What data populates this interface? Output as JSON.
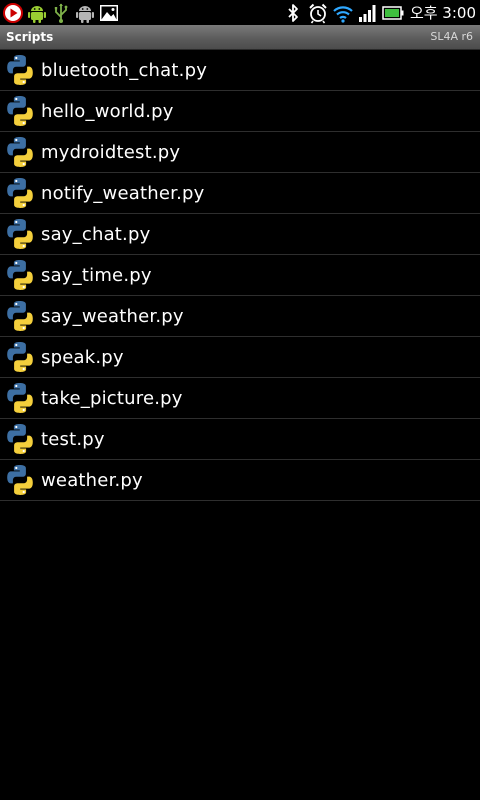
{
  "status_bar": {
    "left_icons": [
      "media-play-icon",
      "android-icon",
      "usb-icon",
      "android-debug-icon",
      "gallery-icon"
    ],
    "right_icons": [
      "bluetooth-icon",
      "alarm-icon",
      "wifi-icon",
      "signal-icon",
      "battery-icon"
    ],
    "clock": "오후 3:00"
  },
  "title_bar": {
    "title": "Scripts",
    "version": "SL4A r6"
  },
  "scripts": [
    {
      "name": "bluetooth_chat.py"
    },
    {
      "name": "hello_world.py"
    },
    {
      "name": "mydroidtest.py"
    },
    {
      "name": "notify_weather.py"
    },
    {
      "name": "say_chat.py"
    },
    {
      "name": "say_time.py"
    },
    {
      "name": "say_weather.py"
    },
    {
      "name": "speak.py"
    },
    {
      "name": "take_picture.py"
    },
    {
      "name": "test.py"
    },
    {
      "name": "weather.py"
    }
  ],
  "colors": {
    "background": "#000000",
    "python_blue": "#3d6fa3",
    "python_yellow": "#f4cf3c",
    "divider": "#2e2e2e"
  }
}
